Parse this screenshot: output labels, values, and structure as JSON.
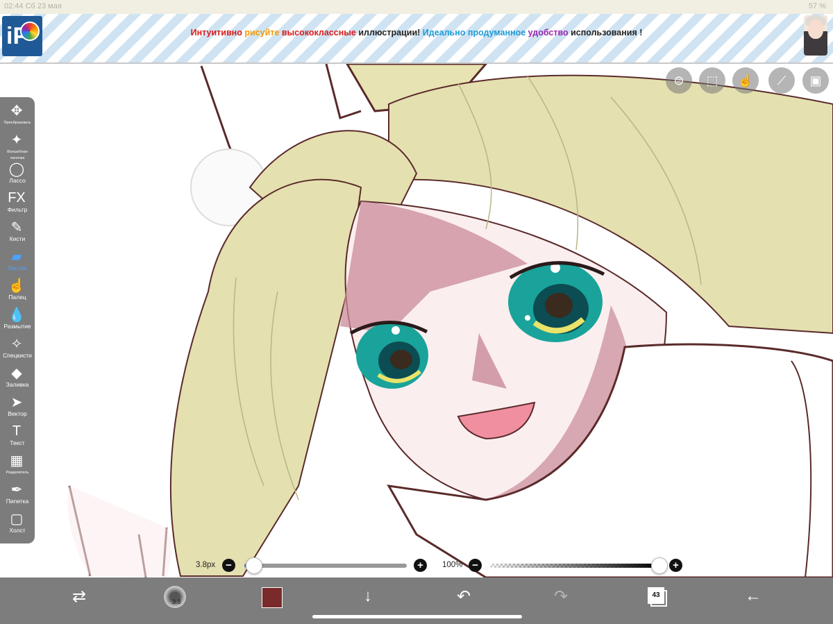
{
  "status_bar": {
    "left": "02:44  Сб 23 мая",
    "right": "57 %"
  },
  "banner": {
    "segments": [
      {
        "text": "Интуитивно ",
        "color": "red"
      },
      {
        "text": "рисуйте ",
        "color": "orange"
      },
      {
        "text": "высококлассные ",
        "color": "red"
      },
      {
        "text": "иллюстрации! ",
        "color": "dark"
      },
      {
        "text": "Идеально продуманное ",
        "color": "blue"
      },
      {
        "text": "удобство ",
        "color": "purple"
      },
      {
        "text": "использования !",
        "color": "dark"
      }
    ],
    "logo_text": "iP"
  },
  "top_tools": [
    {
      "name": "toggle-icon"
    },
    {
      "name": "selection-icon"
    },
    {
      "name": "hand-touch-icon"
    },
    {
      "name": "ruler-icon"
    },
    {
      "name": "reference-image-icon"
    }
  ],
  "tools": [
    {
      "name": "tool-transform",
      "icon": "move-icon",
      "glyph": "✥",
      "label": "Преобразовать",
      "small": true
    },
    {
      "name": "tool-magic-wand",
      "icon": "magic-wand-icon",
      "glyph": "✦",
      "label": "Волшебная палочка",
      "small": true
    },
    {
      "name": "tool-lasso",
      "icon": "lasso-icon",
      "glyph": "◯",
      "label": "Лассо"
    },
    {
      "name": "tool-filter",
      "icon": "fx-icon",
      "glyph": "FX",
      "label": "Фильтр"
    },
    {
      "name": "tool-brush",
      "icon": "brush-icon",
      "glyph": "✎",
      "label": "Кисти"
    },
    {
      "name": "tool-eraser",
      "icon": "eraser-icon",
      "glyph": "▰",
      "label": "Ластик",
      "active": true
    },
    {
      "name": "tool-smudge",
      "icon": "finger-icon",
      "glyph": "☝",
      "label": "Палец"
    },
    {
      "name": "tool-blur",
      "icon": "drop-icon",
      "glyph": "💧",
      "label": "Размытие"
    },
    {
      "name": "tool-special-brush",
      "icon": "sparkle-brush-icon",
      "glyph": "✧",
      "label": "Спецкисти"
    },
    {
      "name": "tool-fill",
      "icon": "fill-icon",
      "glyph": "◆",
      "label": "Заливка"
    },
    {
      "name": "tool-vector",
      "icon": "cursor-icon",
      "glyph": "➤",
      "label": "Вектор"
    },
    {
      "name": "tool-text",
      "icon": "text-icon",
      "glyph": "T",
      "label": "Текст"
    },
    {
      "name": "tool-divider",
      "icon": "panel-divider-icon",
      "glyph": "▦",
      "label": "Разделитель",
      "small": true
    },
    {
      "name": "tool-eyedropper",
      "icon": "eyedropper-icon",
      "glyph": "✒",
      "label": "Пипетка"
    },
    {
      "name": "tool-canvas",
      "icon": "canvas-icon",
      "glyph": "▢",
      "label": "Холст"
    }
  ],
  "brush_size": {
    "label": "3.8px",
    "value": 3.8
  },
  "opacity": {
    "label": "100%",
    "value": 100
  },
  "bottom": {
    "brush_preview_label": "3.8",
    "layer_count": "43",
    "current_color": "#7a2a2a"
  }
}
